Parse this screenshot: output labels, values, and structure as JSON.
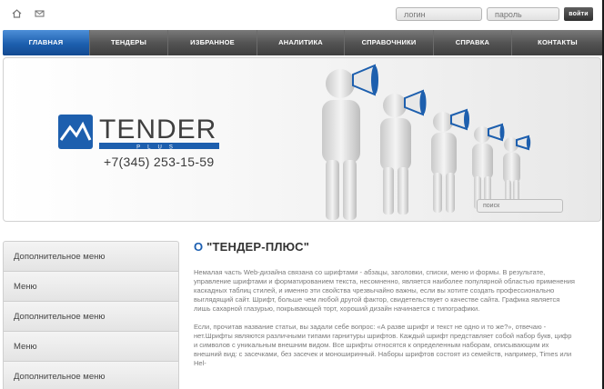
{
  "topbar": {
    "icons": [
      "home-icon",
      "mail-icon"
    ],
    "login_placeholder": "логин",
    "password_placeholder": "пароль",
    "login_button": "войти"
  },
  "nav": {
    "items": [
      {
        "label": "Главная",
        "active": true
      },
      {
        "label": "Тендеры",
        "active": false
      },
      {
        "label": "Избранное",
        "active": false
      },
      {
        "label": "Аналитика",
        "active": false
      },
      {
        "label": "Справочники",
        "active": false
      },
      {
        "label": "Справка",
        "active": false
      },
      {
        "label": "Контакты",
        "active": false
      }
    ]
  },
  "banner": {
    "logo_word": "TENDER",
    "logo_sub": "PLUS",
    "phone": "+7(345) 253-15-59",
    "search_placeholder": "поиск"
  },
  "sidemenu": {
    "items": [
      "Дополнительное меню",
      "Меню",
      "Дополнительное меню",
      "Меню",
      "Дополнительное меню"
    ]
  },
  "content": {
    "title_prefix": "О",
    "title_rest": "\"ТЕНДЕР-ПЛЮС\"",
    "paragraphs": [
      "Немалая часть Web-дизайна связана со шрифтами - абзацы, заголовки, списки, меню и формы. В результате, управление шрифтами и форматированием текста, несомненно, является наиболее популярной областью применения каскадных таблиц стилей, и именно эти свойства чрезвычайно важны, если вы хотите создать профессионально выглядящий сайт. Шрифт, больше чем любой другой фактор, свидетельствует о качестве сайта. Графика является лишь сахарной глазурью, покрывающей торт, хороший дизайн начинается с типографики.",
      "Если, прочитав название статьи, вы задали себе вопрос: «А разве шрифт и текст не одно и то же?», отвечаю - нет.Шрифты являются различными типами гарнитуры шрифтов. Каждый шрифт представляет собой набор букв, цифр и символов с уникальным внешним видом. Все шрифты относятся к определенным наборам, описывающим их внешний вид: с засечками, без засечек и моноширинный. Наборы шрифтов состоят из семейств, например, Times или Hel-"
    ]
  },
  "colors": {
    "accent_blue": "#1d5fae",
    "nav_dark": "#4a4a4a",
    "text_gray": "#7a7a7a"
  }
}
